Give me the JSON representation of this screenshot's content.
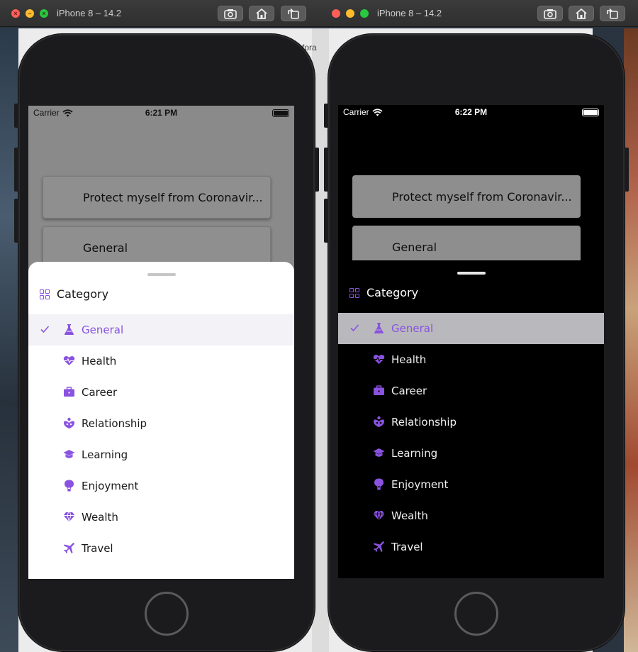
{
  "behind": {
    "peek_text": "mfora"
  },
  "windows": [
    {
      "title": "iPhone 8 – 14.2",
      "mode": "light",
      "status": {
        "carrier": "Carrier",
        "time": "6:21 PM"
      },
      "cards": [
        "Protect myself from Coronavir...",
        "General"
      ],
      "sheet": {
        "header": "Category",
        "items": [
          {
            "label": "General",
            "icon": "flask-icon",
            "selected": true
          },
          {
            "label": "Health",
            "icon": "heartbeat-icon",
            "selected": false
          },
          {
            "label": "Career",
            "icon": "briefcase-icon",
            "selected": false
          },
          {
            "label": "Relationship",
            "icon": "relationship-icon",
            "selected": false
          },
          {
            "label": "Learning",
            "icon": "graduation-cap-icon",
            "selected": false
          },
          {
            "label": "Enjoyment",
            "icon": "hot-air-balloon-icon",
            "selected": false
          },
          {
            "label": "Wealth",
            "icon": "diamond-icon",
            "selected": false
          },
          {
            "label": "Travel",
            "icon": "airplane-icon",
            "selected": false
          }
        ]
      }
    },
    {
      "title": "iPhone 8 – 14.2",
      "mode": "dark",
      "status": {
        "carrier": "Carrier",
        "time": "6:22 PM"
      },
      "cards": [
        "Protect myself from Coronavir...",
        "General"
      ],
      "sheet": {
        "header": "Category",
        "items": [
          {
            "label": "General",
            "icon": "flask-icon",
            "selected": true
          },
          {
            "label": "Health",
            "icon": "heartbeat-icon",
            "selected": false
          },
          {
            "label": "Career",
            "icon": "briefcase-icon",
            "selected": false
          },
          {
            "label": "Relationship",
            "icon": "relationship-icon",
            "selected": false
          },
          {
            "label": "Learning",
            "icon": "graduation-cap-icon",
            "selected": false
          },
          {
            "label": "Enjoyment",
            "icon": "hot-air-balloon-icon",
            "selected": false
          },
          {
            "label": "Wealth",
            "icon": "diamond-icon",
            "selected": false
          },
          {
            "label": "Travel",
            "icon": "airplane-icon",
            "selected": false
          }
        ]
      }
    }
  ],
  "colors": {
    "accent": "#8a52e0",
    "selected_light": "#f3f2f6",
    "selected_dark": "#b9b9bd"
  }
}
